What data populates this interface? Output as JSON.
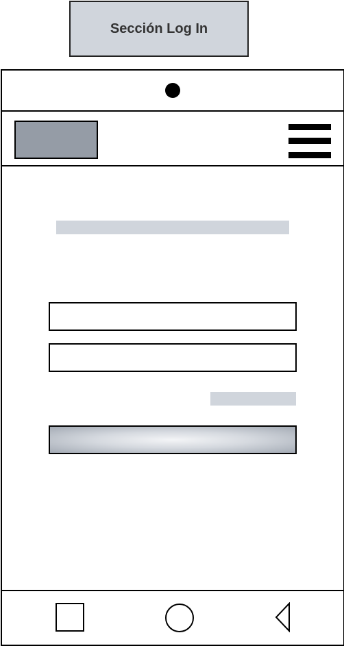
{
  "title": "Sección Log In",
  "header": {
    "logo_icon": "logo-placeholder",
    "menu_icon": "hamburger-menu-icon"
  },
  "form": {
    "heading_placeholder": "text-placeholder",
    "fields": [
      "username-field",
      "password-field"
    ],
    "forgot_link_placeholder": "text-placeholder",
    "submit_button": "login-button"
  },
  "navbar": {
    "icons": [
      "square-recent-apps-icon",
      "circle-home-icon",
      "triangle-back-icon"
    ]
  },
  "colors": {
    "placeholder": "#d0d5dc",
    "logo": "#959ca6",
    "button_edge": "#a3aab4",
    "button_center": "#f4f5f7",
    "outline": "#000000"
  }
}
